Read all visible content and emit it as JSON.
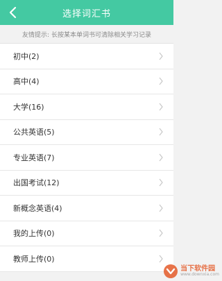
{
  "header": {
    "title": "选择词汇书",
    "back_icon": "chevron-left-icon"
  },
  "tip": "友情提示: 长按某本单词书可清除相关学习记录",
  "books": [
    {
      "label": "初中(2)"
    },
    {
      "label": "高中(4)"
    },
    {
      "label": "大学(16)"
    },
    {
      "label": "公共英语(5)"
    },
    {
      "label": "专业英语(7)"
    },
    {
      "label": "出国考试(12)"
    },
    {
      "label": "新概念英语(4)"
    },
    {
      "label": "我的上传(0)"
    },
    {
      "label": "教师上传(0)"
    }
  ],
  "watermark": {
    "cn": "当下软件园",
    "en": "www.downxia.com"
  },
  "colors": {
    "accent": "#44c9a2",
    "background": "#f2f2f2",
    "text": "#333333"
  }
}
